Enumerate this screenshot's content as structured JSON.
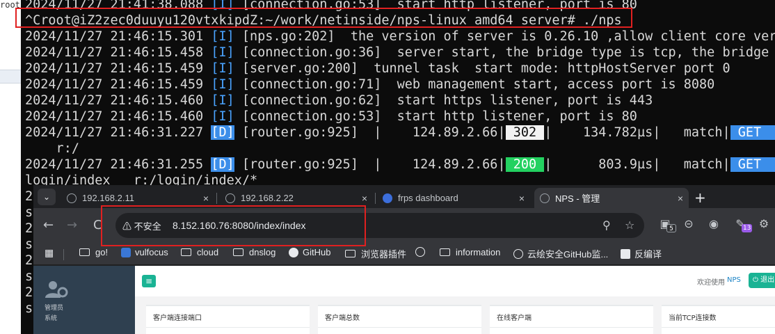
{
  "background": {
    "left_fragment": "root"
  },
  "terminal": {
    "lines": [
      {
        "ts": "2024/11/27 21:41:38.088",
        "tag": "[I]",
        "msg": "[connection.go:53]  start http listener, port is 80"
      },
      {
        "prompt": "^Croot@iZ2zec0duuyu120vtxkipdZ:~/work/netinside/nps-linux_amd64_server# ./nps"
      },
      {
        "ts": "2024/11/27 21:46:15.301",
        "tag": "[I]",
        "msg": "[nps.go:202]  the version of server is 0.26.10 ,allow client core vers"
      },
      {
        "ts": "2024/11/27 21:46:15.458",
        "tag": "[I]",
        "msg": "[connection.go:36]  server start, the bridge type is tcp, the bridge p"
      },
      {
        "ts": "2024/11/27 21:46:15.459",
        "tag": "[I]",
        "msg": "[server.go:200]  tunnel task  start mode: httpHostServer port 0"
      },
      {
        "ts": "2024/11/27 21:46:15.459",
        "tag": "[I]",
        "msg": "[connection.go:71]  web management start, access port is 8080"
      },
      {
        "ts": "2024/11/27 21:46:15.460",
        "tag": "[I]",
        "msg": "[connection.go:62]  start https listener, port is 443"
      },
      {
        "ts": "2024/11/27 21:46:15.460",
        "tag": "[I]",
        "msg": "[connection.go:53]  start http listener, port is 80"
      },
      {
        "ts": "2024/11/27 21:46:31.227",
        "tag": "[D]",
        "router": "[router.go:925]  |    124.89.2.66|",
        "status": " 302 ",
        "timing": "|    134.782µs|   match|",
        "method": " GET    "
      },
      {
        "cont": "    r:/"
      },
      {
        "ts": "2024/11/27 21:46:31.255",
        "tag": "[D]",
        "router": "[router.go:925]  |    124.89.2.66|",
        "status": " 200 ",
        "timing": "|      803.9µs|   match|",
        "method": " GET    "
      },
      {
        "cont": "login/index   r:/login/index/*"
      },
      {
        "cont": "2"
      },
      {
        "cont": "s"
      },
      {
        "cont": "2"
      },
      {
        "cont": "s"
      },
      {
        "cont": "2"
      },
      {
        "cont": "s"
      },
      {
        "cont": "2"
      },
      {
        "cont": "s"
      }
    ],
    "highlight_color": "#e02020"
  },
  "browser": {
    "tabs": [
      {
        "label": "192.168.2.11",
        "close": "×"
      },
      {
        "label": "192.168.2.22",
        "close": "×"
      },
      {
        "label": "frps dashboard",
        "close": "×"
      },
      {
        "label": "NPS - 管理",
        "close": "×"
      }
    ],
    "new_tab": "+",
    "tab_menu": "⌄",
    "nav": {
      "back": "←",
      "forward": "→",
      "reload": "C"
    },
    "omnibox": {
      "security": "⚠ 不安全",
      "url": "8.152.160.76:8080/index/index",
      "zoom_icon": "zoom-icon",
      "star_icon": "star-icon"
    },
    "extensions": [
      {
        "name": "extension-badge-icon",
        "badge": "5"
      },
      {
        "name": "extension-minus-icon",
        "badge": ""
      },
      {
        "name": "extension-glasses-icon",
        "badge": ""
      },
      {
        "name": "extension-puzzle-badge-icon",
        "badge": "13"
      },
      {
        "name": "extensions-puzzle-icon",
        "badge": ""
      }
    ],
    "bookmarks": [
      {
        "label": "go!",
        "icon": "folder"
      },
      {
        "label": "vulfocus",
        "icon": "shield"
      },
      {
        "label": "cloud",
        "icon": "folder"
      },
      {
        "label": "dnslog",
        "icon": "folder"
      },
      {
        "label": "GitHub",
        "icon": "github"
      },
      {
        "label": "浏览器插件",
        "icon": "folder"
      },
      {
        "label": "",
        "icon": "globe"
      },
      {
        "label": "information",
        "icon": "folder"
      },
      {
        "label": "云绘安全GitHub监...",
        "icon": "globe"
      },
      {
        "label": "反编译",
        "icon": "app"
      }
    ],
    "bookmarks_icon": "apps-grid-icon"
  },
  "nps": {
    "sidebar": {
      "line1": "管理员",
      "line2": "系统"
    },
    "menu_button": "≡",
    "welcome_text": "欢迎使用",
    "welcome_brand": "NPS",
    "exit_button": "⏻ 退出",
    "cards": [
      {
        "title": "客户端连接端口"
      },
      {
        "title": "客户端总数"
      },
      {
        "title": "在线客户端"
      },
      {
        "title": "当前TCP连接数"
      }
    ],
    "accent": "#1ab394",
    "sidebar_color": "#2f4050"
  }
}
